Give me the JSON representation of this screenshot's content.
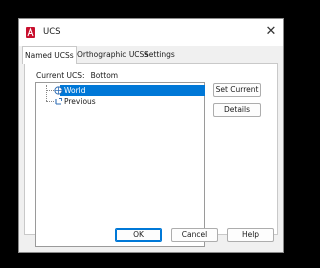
{
  "dialog": {
    "title": "UCS",
    "close_symbol": "✕"
  },
  "tabs": [
    {
      "label": "Named UCSs",
      "active": true
    },
    {
      "label": "Orthographic UCSs",
      "active": false
    },
    {
      "label": "Settings",
      "active": false
    }
  ],
  "current_ucs": {
    "label": "Current UCS:",
    "value": "Bottom"
  },
  "tree": {
    "items": [
      {
        "label": "World",
        "selected": true,
        "icon": "ucs-world-icon"
      },
      {
        "label": "Previous",
        "selected": false,
        "icon": "ucs-previous-icon"
      }
    ]
  },
  "side_buttons": {
    "set_current": "Set Current",
    "details": "Details"
  },
  "footer_buttons": {
    "ok": "OK",
    "cancel": "Cancel",
    "help": "Help"
  },
  "colors": {
    "selection": "#0078d7",
    "app_icon": "#c8102e",
    "icon_blue": "#2f6db5"
  }
}
